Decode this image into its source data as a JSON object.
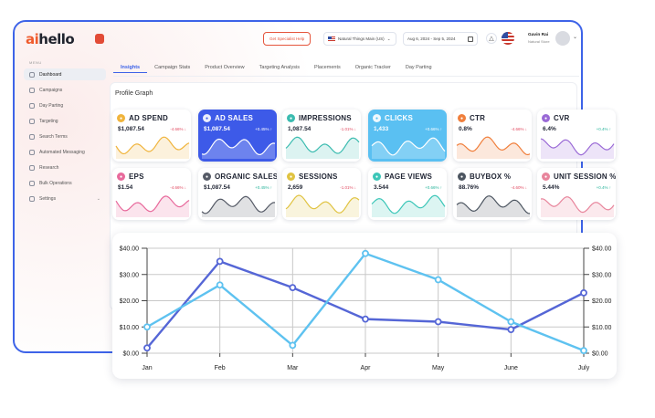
{
  "header": {
    "logo_prefix": "ai",
    "logo_suffix": "hello",
    "help_button": "Get Specialist Help",
    "market": "Natural Things Main (US)",
    "date_range": "Aug 6, 2024 - Sep 5, 2024",
    "user_name": "Gavin Rai",
    "user_role": "Natural Store"
  },
  "sidebar": {
    "caption": "MENU",
    "items": [
      {
        "label": "Dashboard",
        "icon": "home-icon",
        "active": true
      },
      {
        "label": "Campaigns",
        "icon": "bar-chart-icon"
      },
      {
        "label": "Day Parting",
        "icon": "clock-icon"
      },
      {
        "label": "Targeting",
        "icon": "target-icon"
      },
      {
        "label": "Search Terms",
        "icon": "search-icon"
      },
      {
        "label": "Automated Messaging",
        "icon": "message-icon"
      },
      {
        "label": "Research",
        "icon": "document-icon"
      },
      {
        "label": "Bulk Operations",
        "icon": "layers-icon"
      },
      {
        "label": "Settings",
        "icon": "gear-icon"
      }
    ]
  },
  "tabs": [
    "Insights",
    "Campaign Stats",
    "Product Overview",
    "Targeting Analysis",
    "Placements",
    "Organic Tracker",
    "Day Parting"
  ],
  "panel_title": "Profile Graph",
  "cards": [
    {
      "title": "AD SPEND",
      "value": "$1,087.54",
      "change": "-4.66% ↓",
      "dir": "down",
      "accent": "#f0b43c",
      "icon_bg": "#f0b43c",
      "style": "white"
    },
    {
      "title": "AD SALES",
      "value": "$1,087.54",
      "change": "+0.45% ↑",
      "dir": "up",
      "accent": "#ffffff",
      "icon_bg": "#ffffff",
      "style": "blue"
    },
    {
      "title": "IMPRESSIONS",
      "value": "1,087.54",
      "change": "-1.01% ↓",
      "dir": "down",
      "accent": "#3cbcb0",
      "icon_bg": "#3cbcb0",
      "style": "white"
    },
    {
      "title": "CLICKS",
      "value": "1,433",
      "change": "+0.66% ↑",
      "dir": "up",
      "accent": "#ffffff",
      "icon_bg": "#ffffff",
      "style": "cyan"
    },
    {
      "title": "CTR",
      "value": "0.8%",
      "change": "-4.66% ↓",
      "dir": "down",
      "accent": "#f07f3c",
      "icon_bg": "#f07f3c",
      "style": "white"
    },
    {
      "title": "CVR",
      "value": "6.4%",
      "change": "+0.4% ↑",
      "dir": "up",
      "accent": "#9a6ad6",
      "icon_bg": "#9a6ad6",
      "style": "white"
    },
    {
      "title": "EPS",
      "value": "$1.54",
      "change": "-4.66% ↓",
      "dir": "down",
      "accent": "#e86a9c",
      "icon_bg": "#e86a9c",
      "style": "white"
    },
    {
      "title": "ORGANIC SALES",
      "value": "$1,087.54",
      "change": "+0.45% ↑",
      "dir": "up",
      "accent": "#555a66",
      "icon_bg": "#555a66",
      "style": "white"
    },
    {
      "title": "SESSIONS",
      "value": "2,659",
      "change": "-1.01% ↓",
      "dir": "down",
      "accent": "#e0c341",
      "icon_bg": "#e0c341",
      "style": "white"
    },
    {
      "title": "PAGE VIEWS",
      "value": "3.544",
      "change": "+0.66% ↑",
      "dir": "up",
      "accent": "#3cc6b8",
      "icon_bg": "#3cc6b8",
      "style": "white"
    },
    {
      "title": "BUYBOX %",
      "value": "88.76%",
      "change": "-4.60% ↓",
      "dir": "down",
      "accent": "#4c5560",
      "icon_bg": "#4c5560",
      "style": "white"
    },
    {
      "title": "UNIT SESSION %",
      "value": "5.44%",
      "change": "+0.4% ↑",
      "dir": "up",
      "accent": "#e8859c",
      "icon_bg": "#e8859c",
      "style": "white"
    }
  ],
  "chart_data": {
    "type": "line",
    "categories": [
      "Jan",
      "Feb",
      "Mar",
      "Apr",
      "May",
      "June",
      "July"
    ],
    "ylim": [
      0,
      40
    ],
    "yticks": [
      "$0.00",
      "$10.00",
      "$20.00",
      "$30.00",
      "$40.00"
    ],
    "grid": true,
    "series": [
      {
        "color": "#5566d6",
        "values": [
          2,
          35,
          25,
          13,
          12,
          9,
          23
        ]
      },
      {
        "color": "#5ec2f0",
        "values": [
          10,
          26,
          3,
          38,
          28,
          12,
          1
        ]
      }
    ]
  }
}
